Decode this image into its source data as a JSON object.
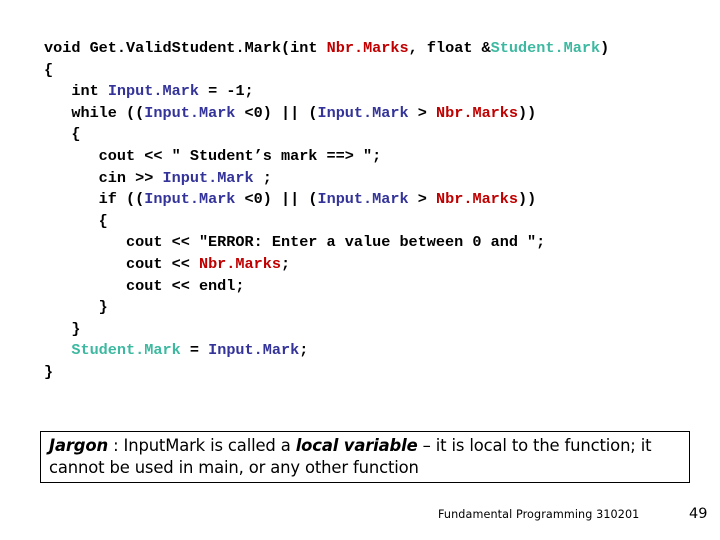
{
  "slide": {
    "code": {
      "language": "cpp",
      "colors": {
        "plain": "#000000",
        "nbr_marks": "#c00000",
        "student_mark": "#3cb9a0",
        "input_mark": "#333399"
      },
      "lines": [
        [
          {
            "t": "void Get",
            "c": "plain"
          },
          {
            "t": ".",
            "c": "plain"
          },
          {
            "t": "Valid",
            "c": "plain"
          },
          {
            "t": "Student",
            "c": "plain"
          },
          {
            "t": ".",
            "c": "plain"
          },
          {
            "t": "Mark(int ",
            "c": "plain"
          },
          {
            "t": "Nbr",
            "c": "nbr"
          },
          {
            "t": ".",
            "c": "nbr"
          },
          {
            "t": "Marks",
            "c": "nbr"
          },
          {
            "t": ", float &",
            "c": "plain"
          },
          {
            "t": "Student",
            "c": "stu"
          },
          {
            "t": ".",
            "c": "stu"
          },
          {
            "t": "Mark",
            "c": "stu"
          },
          {
            "t": ")",
            "c": "plain"
          }
        ],
        [
          {
            "t": "{",
            "c": "plain"
          }
        ],
        [
          {
            "t": "   int ",
            "c": "plain"
          },
          {
            "t": "Input",
            "c": "inp"
          },
          {
            "t": ".",
            "c": "inp"
          },
          {
            "t": "Mark",
            "c": "inp"
          },
          {
            "t": " = -1;",
            "c": "plain"
          }
        ],
        [
          {
            "t": "   while ((",
            "c": "plain"
          },
          {
            "t": "Input",
            "c": "inp"
          },
          {
            "t": ".",
            "c": "inp"
          },
          {
            "t": "Mark",
            "c": "inp"
          },
          {
            "t": " <0) || (",
            "c": "plain"
          },
          {
            "t": "Input",
            "c": "inp"
          },
          {
            "t": ".",
            "c": "inp"
          },
          {
            "t": "Mark",
            "c": "inp"
          },
          {
            "t": " > ",
            "c": "plain"
          },
          {
            "t": "Nbr",
            "c": "nbr"
          },
          {
            "t": ".",
            "c": "nbr"
          },
          {
            "t": "Marks",
            "c": "nbr"
          },
          {
            "t": "))",
            "c": "plain"
          }
        ],
        [
          {
            "t": "   {",
            "c": "plain"
          }
        ],
        [
          {
            "t": "      cout << \" Student’s mark ==> \";",
            "c": "plain"
          }
        ],
        [
          {
            "t": "      cin >> ",
            "c": "plain"
          },
          {
            "t": "Input",
            "c": "inp"
          },
          {
            "t": ".",
            "c": "inp"
          },
          {
            "t": "Mark",
            "c": "inp"
          },
          {
            "t": " ;",
            "c": "plain"
          }
        ],
        [
          {
            "t": "      if ((",
            "c": "plain"
          },
          {
            "t": "Input",
            "c": "inp"
          },
          {
            "t": ".",
            "c": "inp"
          },
          {
            "t": "Mark",
            "c": "inp"
          },
          {
            "t": " <0) || (",
            "c": "plain"
          },
          {
            "t": "Input",
            "c": "inp"
          },
          {
            "t": ".",
            "c": "inp"
          },
          {
            "t": "Mark",
            "c": "inp"
          },
          {
            "t": " > ",
            "c": "plain"
          },
          {
            "t": "Nbr",
            "c": "nbr"
          },
          {
            "t": ".",
            "c": "nbr"
          },
          {
            "t": "Marks",
            "c": "nbr"
          },
          {
            "t": "))",
            "c": "plain"
          }
        ],
        [
          {
            "t": "      {",
            "c": "plain"
          }
        ],
        [
          {
            "t": "         cout << \"ERROR: Enter a value between 0 and \";",
            "c": "plain"
          }
        ],
        [
          {
            "t": "         cout << ",
            "c": "plain"
          },
          {
            "t": "Nbr",
            "c": "nbr"
          },
          {
            "t": ".",
            "c": "nbr"
          },
          {
            "t": "Marks",
            "c": "nbr"
          },
          {
            "t": ";",
            "c": "plain"
          }
        ],
        [
          {
            "t": "         cout << endl;",
            "c": "plain"
          }
        ],
        [
          {
            "t": "      }",
            "c": "plain"
          }
        ],
        [
          {
            "t": "   }",
            "c": "plain"
          }
        ],
        [
          {
            "t": "   ",
            "c": "plain"
          },
          {
            "t": "Student",
            "c": "stu"
          },
          {
            "t": ".",
            "c": "stu"
          },
          {
            "t": "Mark",
            "c": "stu"
          },
          {
            "t": " = ",
            "c": "plain"
          },
          {
            "t": "Input",
            "c": "inp"
          },
          {
            "t": ".",
            "c": "inp"
          },
          {
            "t": "Mark",
            "c": "inp"
          },
          {
            "t": ";",
            "c": "plain"
          }
        ],
        [
          {
            "t": "}",
            "c": "plain"
          }
        ]
      ]
    },
    "jargon": {
      "label": "Jargon",
      "separator": " : ",
      "text_before": "InputMark is called a ",
      "emphasis": "local variable",
      "text_after": " – it is local to the function; it cannot be used in main, or any other function"
    },
    "footer": {
      "course": "Fundamental Programming 310201",
      "page_number": "49"
    }
  }
}
